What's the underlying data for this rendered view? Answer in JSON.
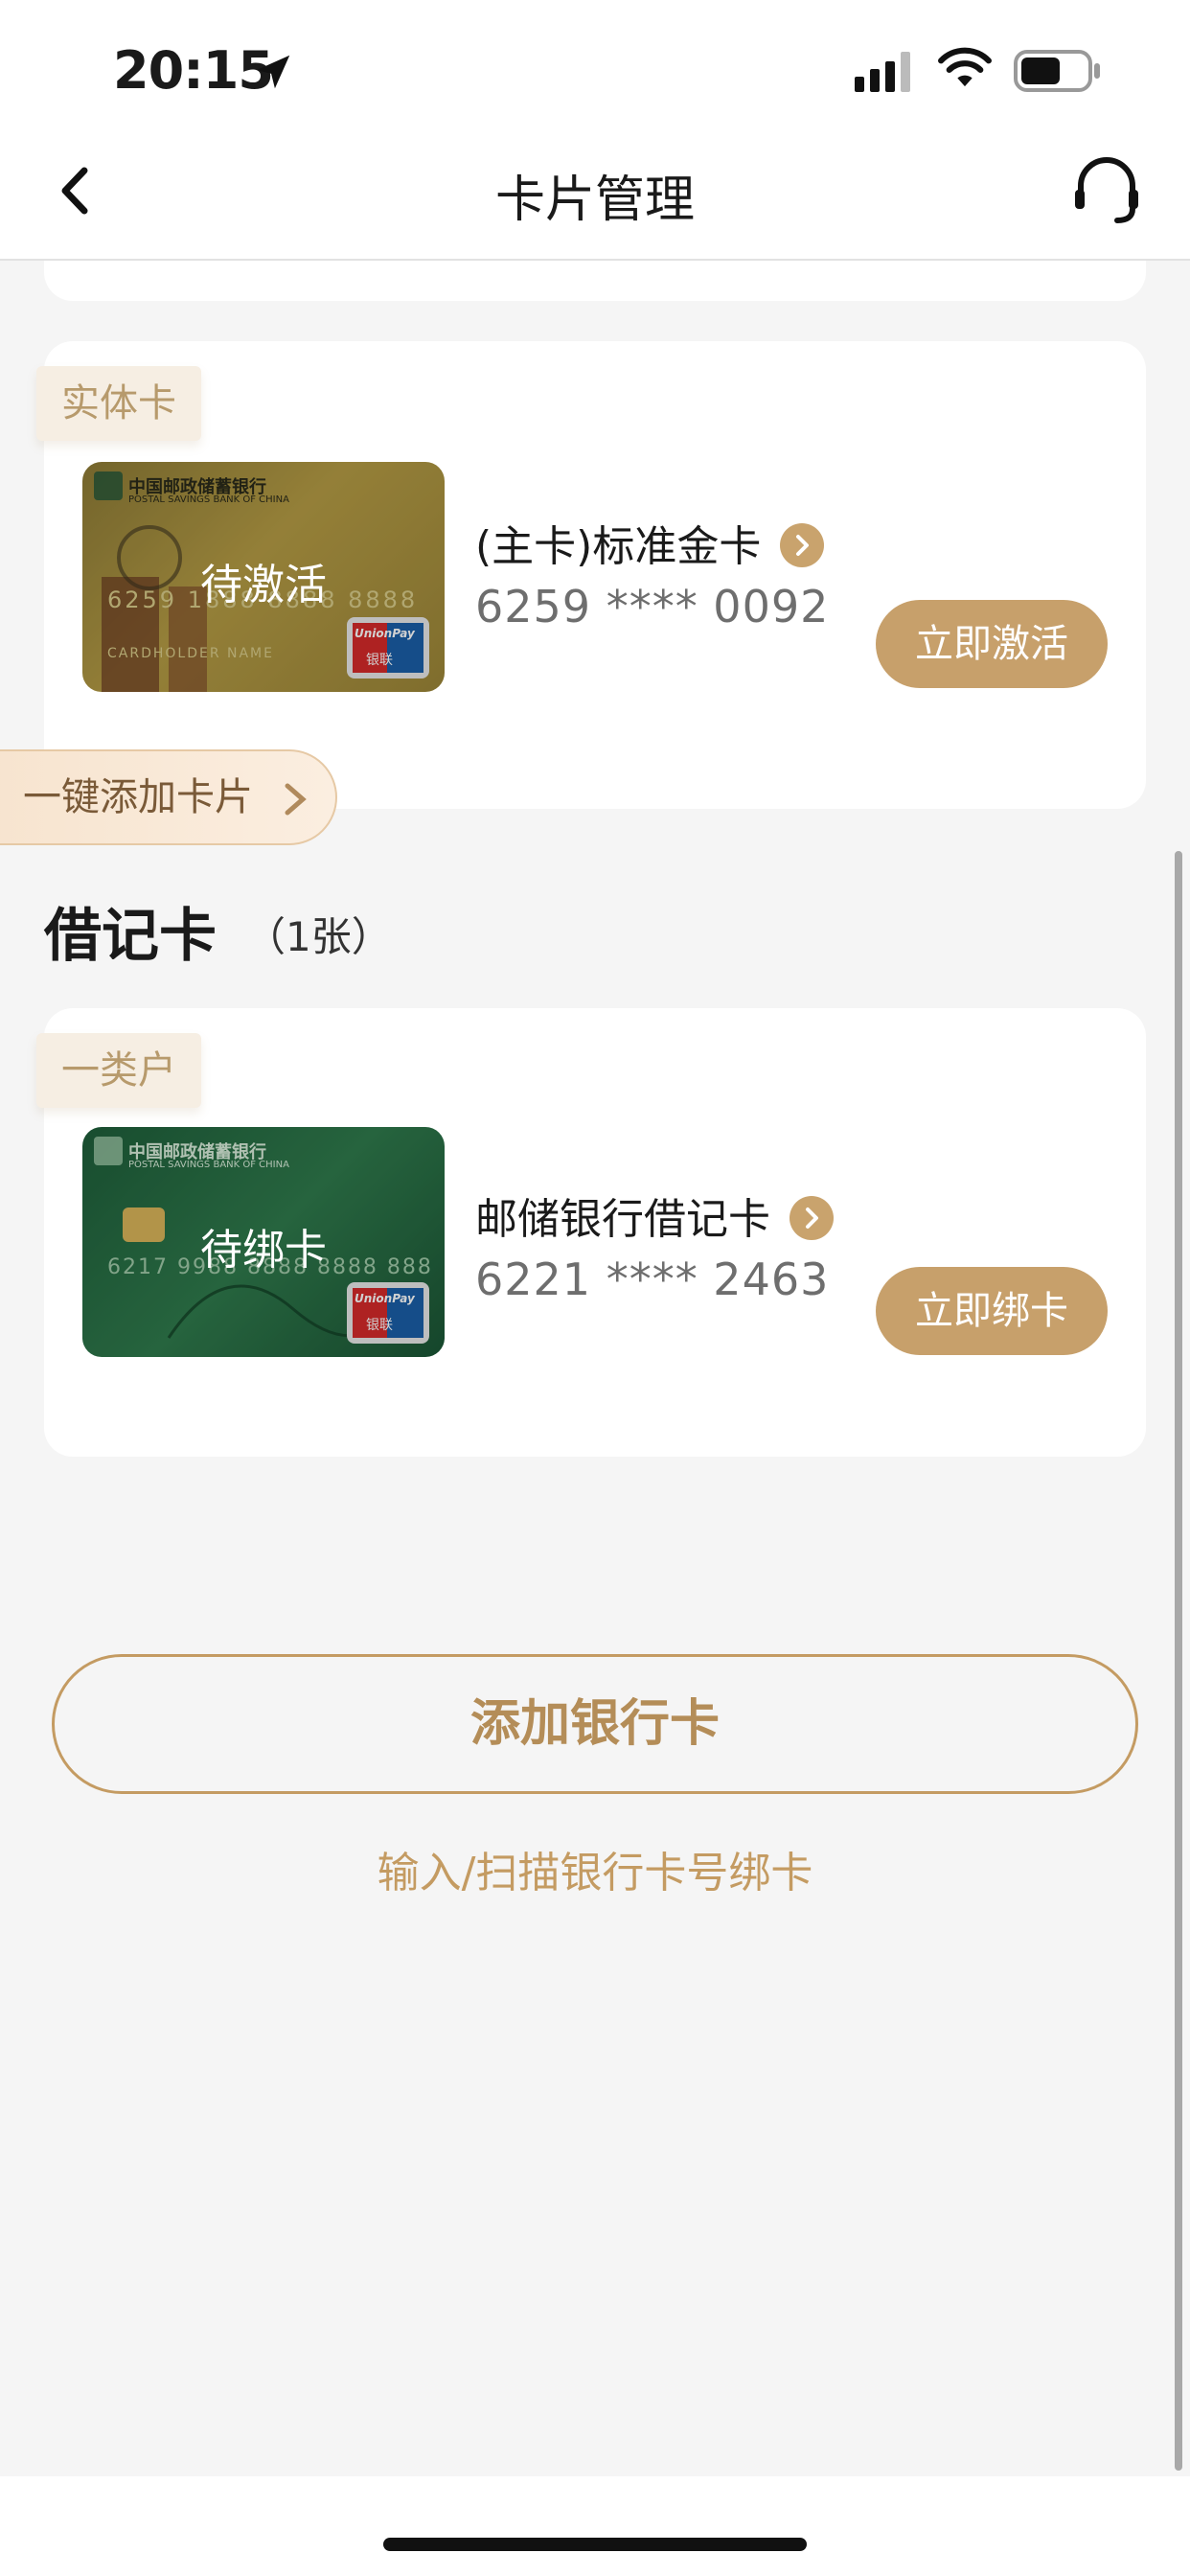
{
  "status_bar": {
    "time": "20:15"
  },
  "nav": {
    "title": "卡片管理"
  },
  "credit_cards": [
    {
      "tag": "实体卡",
      "state": "待激活",
      "name": "(主卡)标准金卡",
      "number": "6259 **** 0092",
      "action": "立即激活",
      "bank_cn": "中国邮政储蓄银行",
      "bank_en": "POSTAL SAVINGS BANK OF CHINA",
      "card_no_face": "6259 1888 8888 8888",
      "holder": "CARDHOLDER NAME",
      "brand": "UnionPay",
      "brand_cn": "银联"
    }
  ],
  "quick_add": {
    "label": "一键添加卡片"
  },
  "debit_section": {
    "title": "借记卡",
    "count": "（1张）"
  },
  "debit_cards": [
    {
      "tag": "一类户",
      "state": "待绑卡",
      "name": "邮储银行借记卡",
      "number": "6221 **** 2463",
      "action": "立即绑卡",
      "bank_cn": "中国邮政储蓄银行",
      "bank_en": "POSTAL SAVINGS BANK OF CHINA",
      "card_no_face": "6217 9988 8888 8888 888",
      "brand": "UnionPay",
      "brand_cn": "银联"
    }
  ],
  "footer": {
    "add_button": "添加银行卡",
    "hint": "输入/扫描银行卡号绑卡"
  },
  "colors": {
    "accent": "#c7a06b",
    "tag_bg": "#f6eee3",
    "background": "#f5f5f5"
  }
}
